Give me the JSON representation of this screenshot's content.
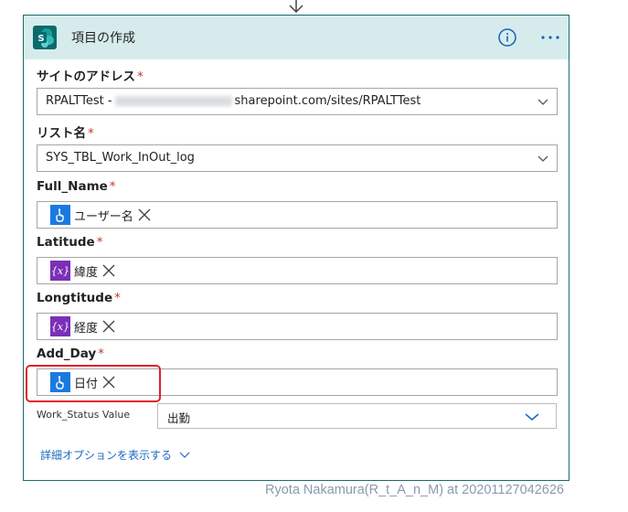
{
  "card": {
    "title": "項目の作成",
    "info_icon": "info-icon",
    "more_icon": "more-icon",
    "sharepoint_icon": "sharepoint-icon"
  },
  "fields": {
    "site": {
      "label": "サイトのアドレス",
      "required": "*",
      "value_prefix": "RPALTTest -",
      "value_suffix": "sharepoint.com/sites/RPALTTest"
    },
    "list": {
      "label": "リスト名",
      "required": "*",
      "value": "SYS_TBL_Work_InOut_log"
    },
    "full_name": {
      "label": "Full_Name",
      "required": "*",
      "token": "ユーザー名",
      "token_icon": "manual-trigger-icon"
    },
    "latitude": {
      "label": "Latitude",
      "required": "*",
      "token": "緯度",
      "token_icon": "variable-icon",
      "token_icon_text": "{x}"
    },
    "longitude": {
      "label": "Longtitude",
      "required": "*",
      "token": "経度",
      "token_icon": "variable-icon",
      "token_icon_text": "{x}"
    },
    "add_day": {
      "label": "Add_Day",
      "required": "*",
      "token": "日付",
      "token_icon": "manual-trigger-icon"
    },
    "work_status": {
      "label": "Work_Status Value",
      "value": "出勤"
    }
  },
  "advanced_options": "詳細オプションを表示する",
  "watermark": "Ryota Nakamura(R_t_A_n_M) at 20201127042626",
  "colors": {
    "header_bg": "#d6ecec",
    "card_border": "#1e6b6b",
    "token_blue": "#1a7ae0",
    "token_purple": "#7a2fb8",
    "highlight": "#e0202a",
    "link": "#1a6ac0"
  }
}
